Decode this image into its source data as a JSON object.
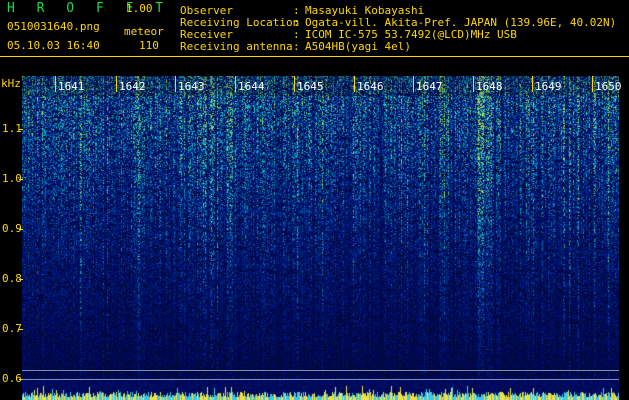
{
  "app": {
    "title": "H R O F F T",
    "version": "1.00",
    "filename": "0510031640.png",
    "mode": "meteor",
    "datetime": "05.10.03 16:40",
    "count": "110"
  },
  "info": [
    {
      "label": "Observer",
      "sep": ":",
      "value": "Masayuki Kobayashi"
    },
    {
      "label": "Receiving Location",
      "sep": ":",
      "value": "Ogata-vill. Akita-Pref. JAPAN (139.96E, 40.02N)"
    },
    {
      "label": "Receiver",
      "sep": ":",
      "value": "ICOM IC-575 53.7492(@LCD)MHz USB"
    },
    {
      "label": "Receiving antenna",
      "sep": ":",
      "value": "A504HB(yagi 4el)"
    }
  ],
  "axis": {
    "unit": "kHz",
    "y_ticks": [
      "1.1",
      "1.0",
      "0.9",
      "0.8",
      "0.7",
      "0.6"
    ],
    "x_ticks": [
      "1641",
      "1642",
      "1643",
      "1644",
      "1645",
      "1646",
      "1647",
      "1648",
      "1649",
      "1650"
    ]
  },
  "colors": {
    "label": "#ffd700",
    "title": "#19d94a",
    "spectrum_low": "#0a1a78",
    "spectrum_mid": "#2aa9d8",
    "spectrum_high": "#b8e63a"
  }
}
